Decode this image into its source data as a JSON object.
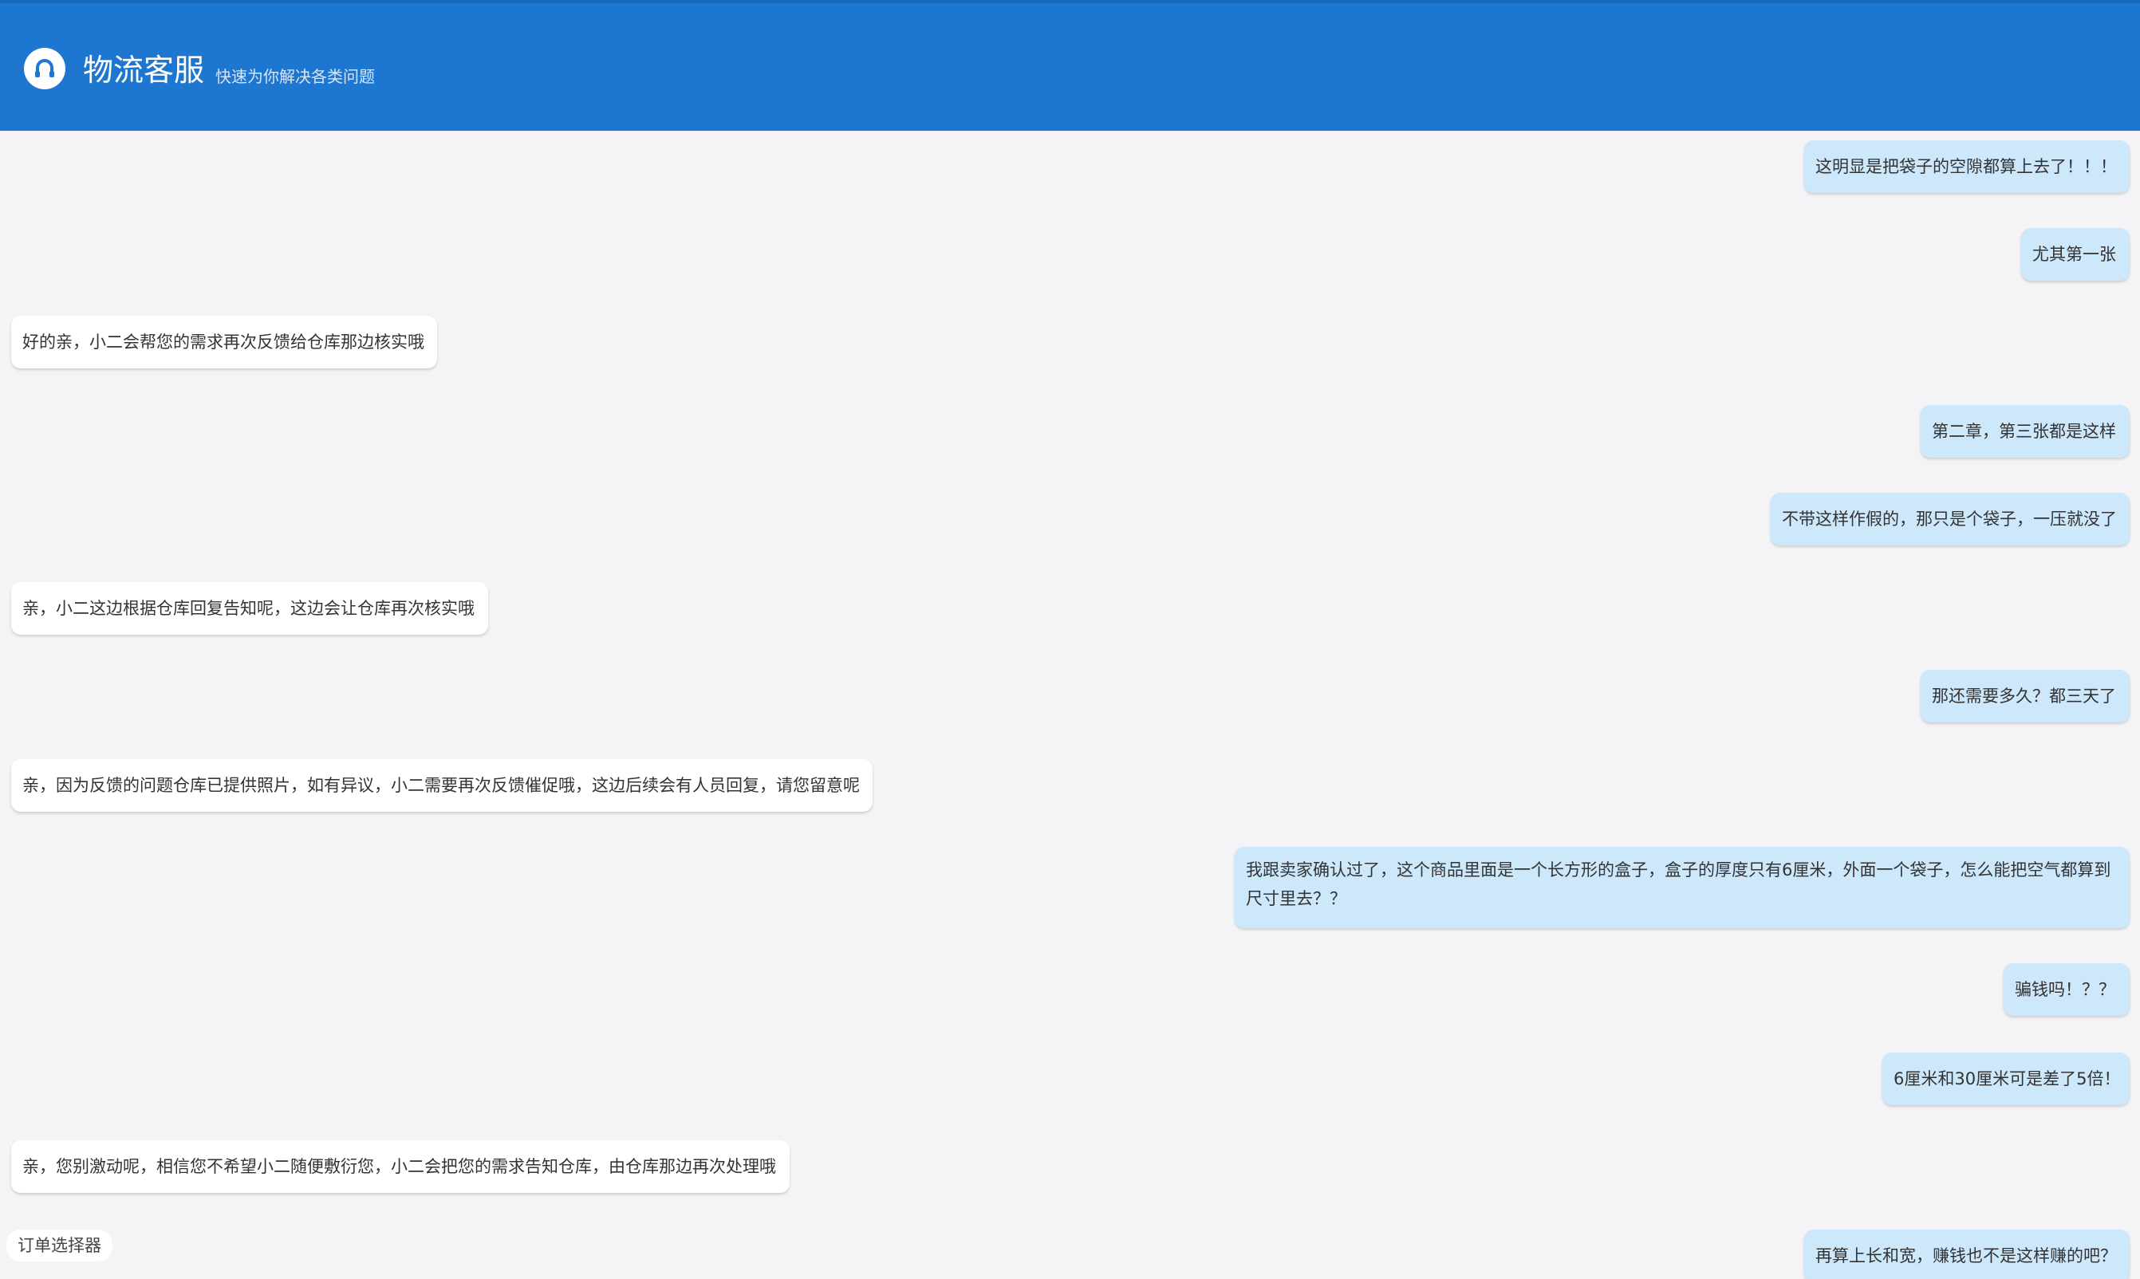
{
  "header": {
    "title": "物流客服",
    "subtitle": "快速为你解决各类问题",
    "logo_icon": "headset-icon"
  },
  "colors": {
    "header_bg": "#1d77d1",
    "user_bubble": "#cde7fb",
    "agent_bubble": "#ffffff",
    "page_bg": "#f4f3f6"
  },
  "messages": [
    {
      "role": "user",
      "text": "这明显是把袋子的空隙都算上去了！！！"
    },
    {
      "role": "user",
      "text": "尤其第一张"
    },
    {
      "role": "agent",
      "text": "好的亲，小二会帮您的需求再次反馈给仓库那边核实哦"
    },
    {
      "role": "user",
      "text": "第二章，第三张都是这样"
    },
    {
      "role": "user",
      "text": "不带这样作假的，那只是个袋子，一压就没了"
    },
    {
      "role": "agent",
      "text": "亲，小二这边根据仓库回复告知呢，这边会让仓库再次核实哦"
    },
    {
      "role": "user",
      "text": "那还需要多久？都三天了"
    },
    {
      "role": "agent",
      "text": "亲，因为反馈的问题仓库已提供照片，如有异议，小二需要再次反馈催促哦，这边后续会有人员回复，请您留意呢"
    },
    {
      "role": "user",
      "text": "我跟卖家确认过了，这个商品里面是一个长方形的盒子，盒子的厚度只有6厘米，外面一个袋子，怎么能把空气都算到尺寸里去？？"
    },
    {
      "role": "user",
      "text": "骗钱吗！？？"
    },
    {
      "role": "user",
      "text": "6厘米和30厘米可是差了5倍！"
    },
    {
      "role": "agent",
      "text": "亲，您别激动呢，相信您不希望小二随便敷衍您，小二会把您的需求告知仓库，由仓库那边再次处理哦"
    },
    {
      "role": "user",
      "text": "再算上长和宽，赚钱也不是这样赚的吧？"
    }
  ],
  "order_selector": {
    "label": "订单选择器"
  }
}
